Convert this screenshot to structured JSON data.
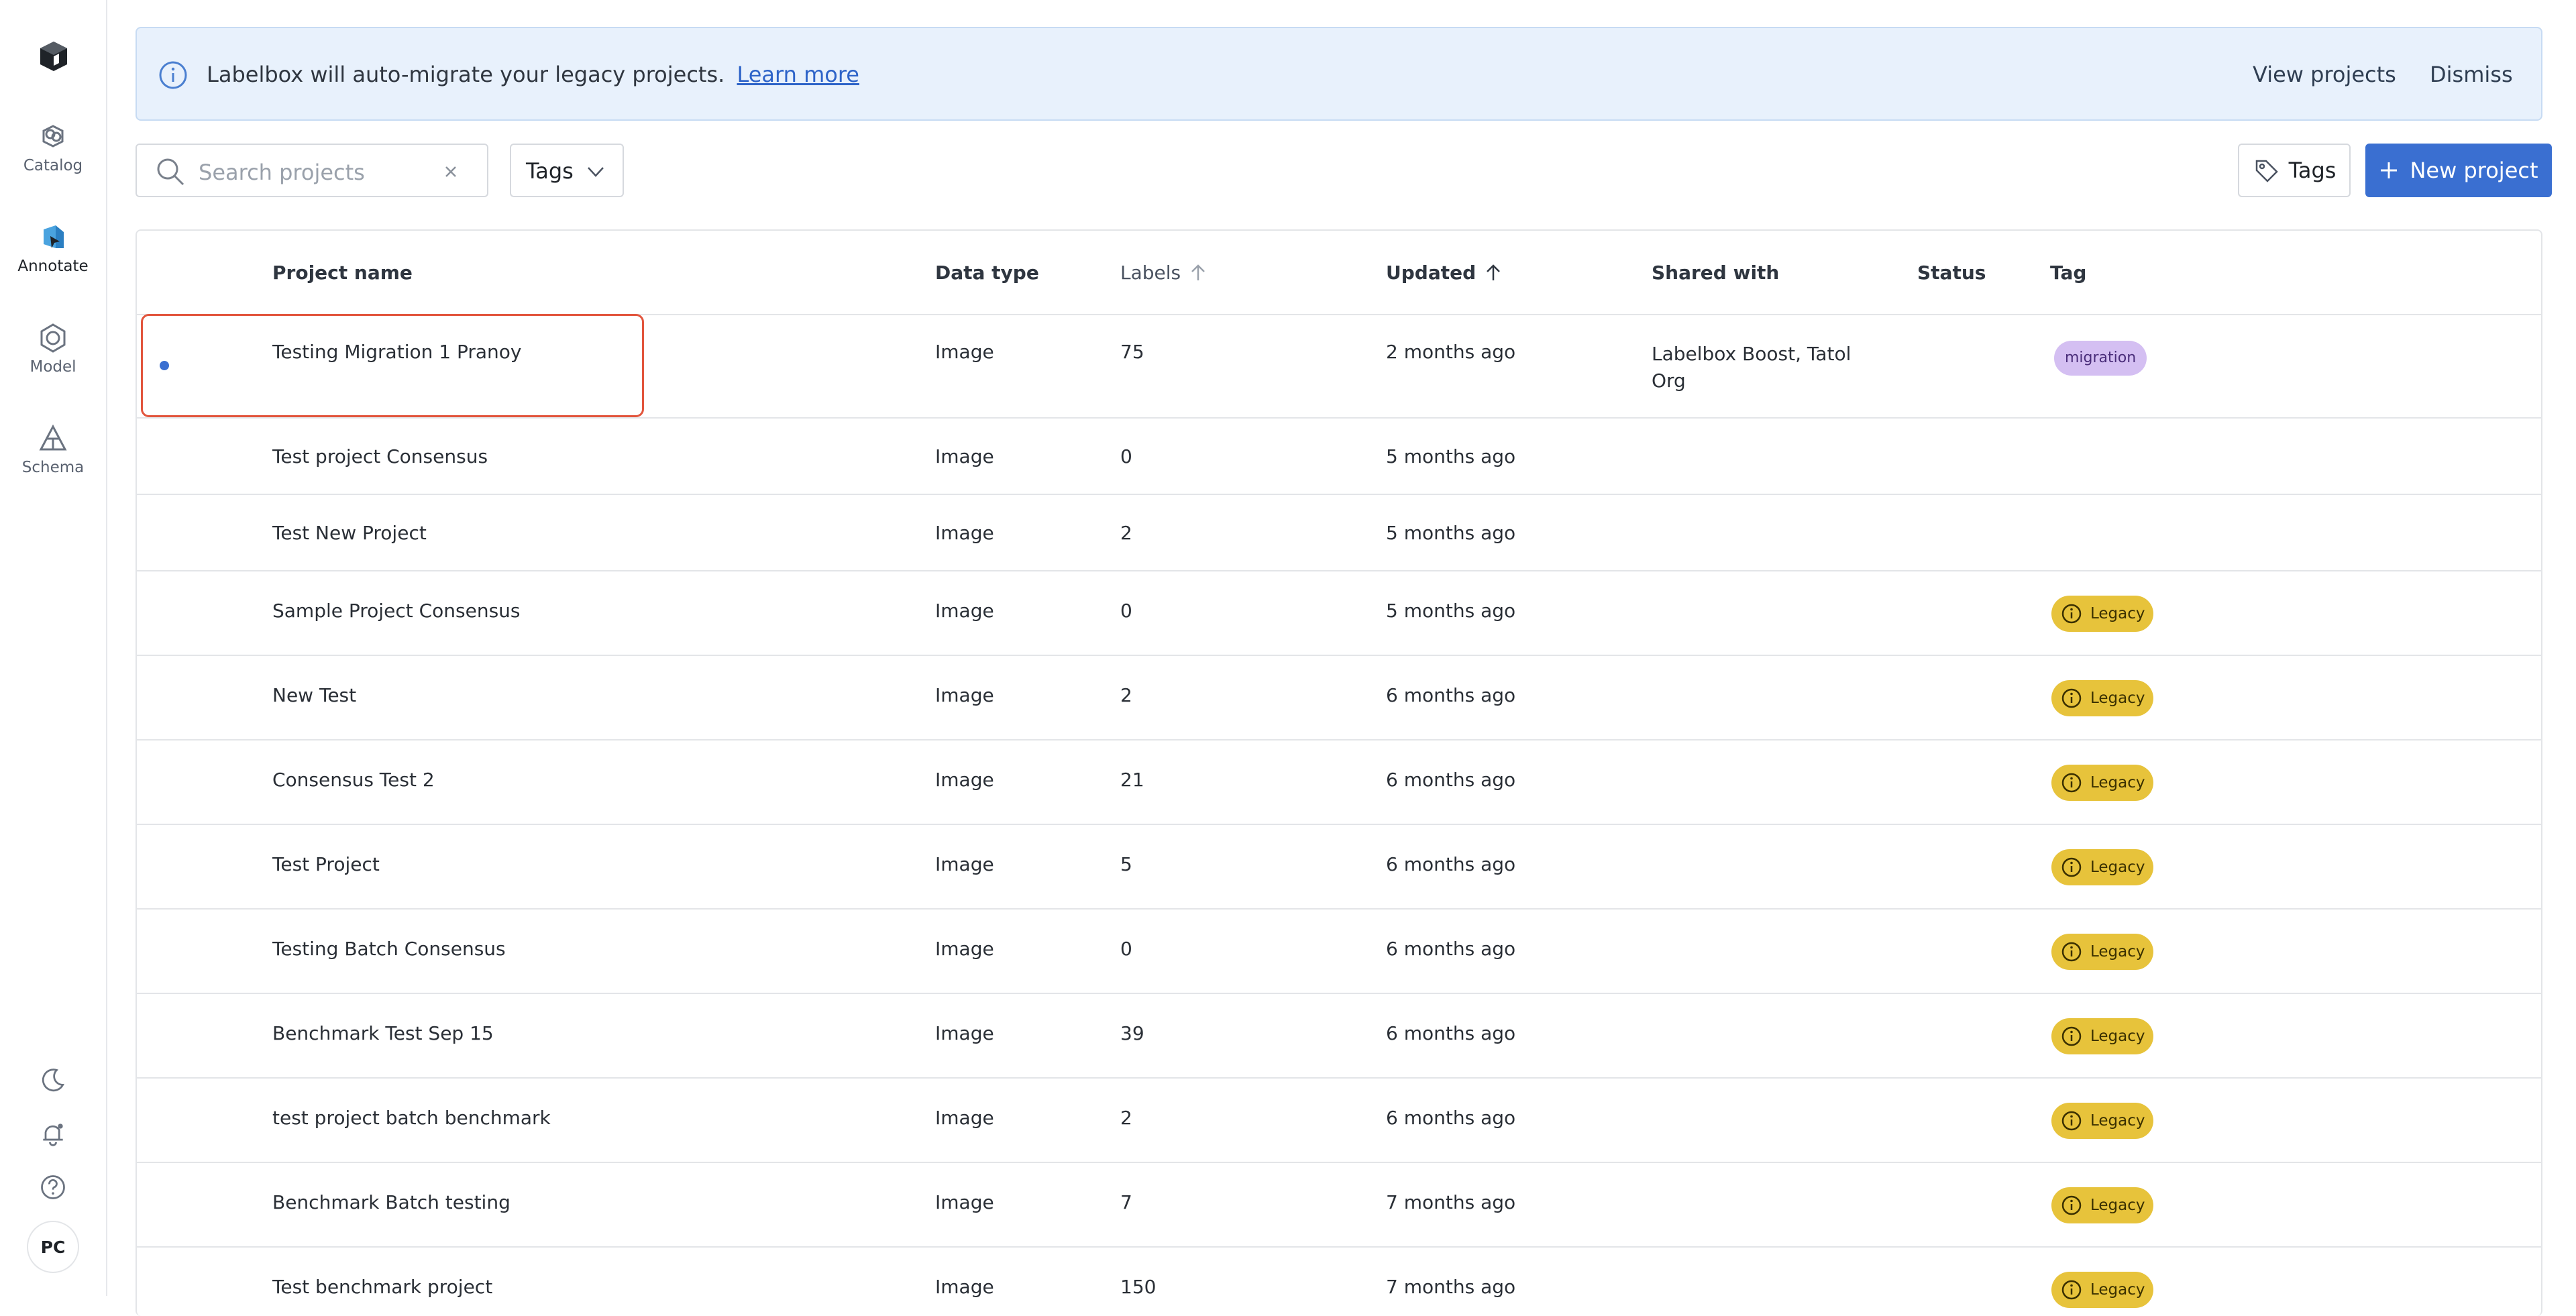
{
  "sidebar": {
    "logo": "labelbox-logo-icon",
    "items": [
      {
        "label": "Catalog",
        "icon": "catalog-icon"
      },
      {
        "label": "Annotate",
        "icon": "annotate-icon",
        "active": true
      },
      {
        "label": "Model",
        "icon": "model-icon"
      },
      {
        "label": "Schema",
        "icon": "schema-icon"
      }
    ],
    "bottom_icons": [
      "moon-icon",
      "bell-icon",
      "help-icon"
    ],
    "avatar_initials": "PC"
  },
  "banner": {
    "message": "Labelbox will auto-migrate your legacy projects.",
    "link": "Learn more",
    "view_projects": "View projects",
    "dismiss": "Dismiss"
  },
  "toolbar": {
    "search_placeholder": "Search projects",
    "search_value": "",
    "tags_filter": "Tags",
    "tags_button": "Tags",
    "new_project": "New project"
  },
  "table": {
    "columns": {
      "name": "Project name",
      "data_type": "Data type",
      "labels": "Labels",
      "updated": "Updated",
      "shared_with": "Shared with",
      "status": "Status",
      "tag": "Tag"
    },
    "rows": [
      {
        "name": "Testing Migration 1 Pranoy",
        "data_type": "Image",
        "labels": "75",
        "updated": "2 months ago",
        "shared_with": "Labelbox Boost, Tatol Org",
        "tag": "migration"
      },
      {
        "name": "Test project Consensus",
        "data_type": "Image",
        "labels": "0",
        "updated": "5 months ago",
        "shared_with": "",
        "tag": ""
      },
      {
        "name": "Test New Project",
        "data_type": "Image",
        "labels": "2",
        "updated": "5 months ago",
        "shared_with": "",
        "tag": ""
      },
      {
        "name": "Sample Project Consensus",
        "data_type": "Image",
        "labels": "0",
        "updated": "5 months ago",
        "shared_with": "",
        "tag": "Legacy"
      },
      {
        "name": "New Test",
        "data_type": "Image",
        "labels": "2",
        "updated": "6 months ago",
        "shared_with": "",
        "tag": "Legacy"
      },
      {
        "name": "Consensus Test 2",
        "data_type": "Image",
        "labels": "21",
        "updated": "6 months ago",
        "shared_with": "",
        "tag": "Legacy"
      },
      {
        "name": "Test Project",
        "data_type": "Image",
        "labels": "5",
        "updated": "6 months ago",
        "shared_with": "",
        "tag": "Legacy"
      },
      {
        "name": "Testing Batch Consensus",
        "data_type": "Image",
        "labels": "0",
        "updated": "6 months ago",
        "shared_with": "",
        "tag": "Legacy"
      },
      {
        "name": "Benchmark Test Sep 15",
        "data_type": "Image",
        "labels": "39",
        "updated": "6 months ago",
        "shared_with": "",
        "tag": "Legacy"
      },
      {
        "name": "test project batch benchmark",
        "data_type": "Image",
        "labels": "2",
        "updated": "6 months ago",
        "shared_with": "",
        "tag": "Legacy"
      },
      {
        "name": "Benchmark Batch testing",
        "data_type": "Image",
        "labels": "7",
        "updated": "7 months ago",
        "shared_with": "",
        "tag": "Legacy"
      },
      {
        "name": "Test benchmark project",
        "data_type": "Image",
        "labels": "150",
        "updated": "7 months ago",
        "shared_with": "",
        "tag": "Legacy"
      }
    ]
  },
  "colors": {
    "accent": "#3a6fd1",
    "banner_bg": "#e8f1fc",
    "legacy_badge": "#e7c33b",
    "migration_badge": "#d4bff2",
    "highlight": "#e2553d"
  }
}
